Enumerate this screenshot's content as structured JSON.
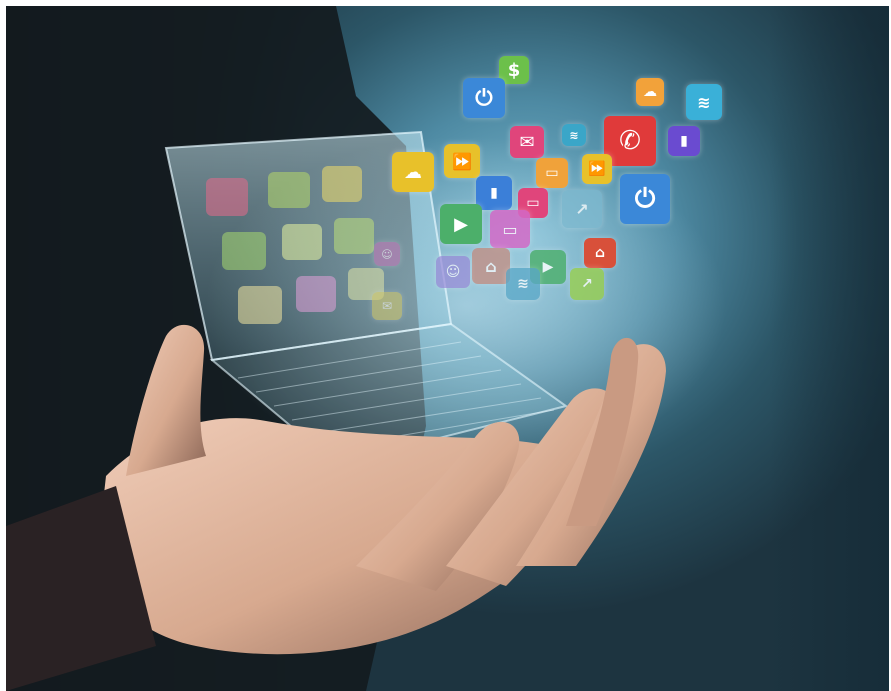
{
  "image": {
    "subject": "hand-holding-holographic-laptop-with-app-icons",
    "colors": {
      "background_dark": "#0d1316",
      "background_teal": "#4e8aa3",
      "skin": "#e2b9a3",
      "hologram": "#bfe6f2"
    }
  },
  "icons": [
    {
      "name": "dollar-icon",
      "color": "#6cc04a"
    },
    {
      "name": "power-icon",
      "color": "#3b88d8"
    },
    {
      "name": "cloud-icon",
      "color": "#f2a23a"
    },
    {
      "name": "wifi-icon",
      "color": "#3ab0d8"
    },
    {
      "name": "mail-icon",
      "color": "#e0457b"
    },
    {
      "name": "phone-icon",
      "color": "#e03a3a"
    },
    {
      "name": "signal-bars-icon",
      "color": "#6a4bd0"
    },
    {
      "name": "fast-forward-icon",
      "color": "#e8c12a"
    },
    {
      "name": "video-camera-icon",
      "color": "#4caf6a"
    },
    {
      "name": "chart-icon",
      "color": "#3b7fd8"
    },
    {
      "name": "home-icon",
      "color": "#d8503a"
    }
  ]
}
